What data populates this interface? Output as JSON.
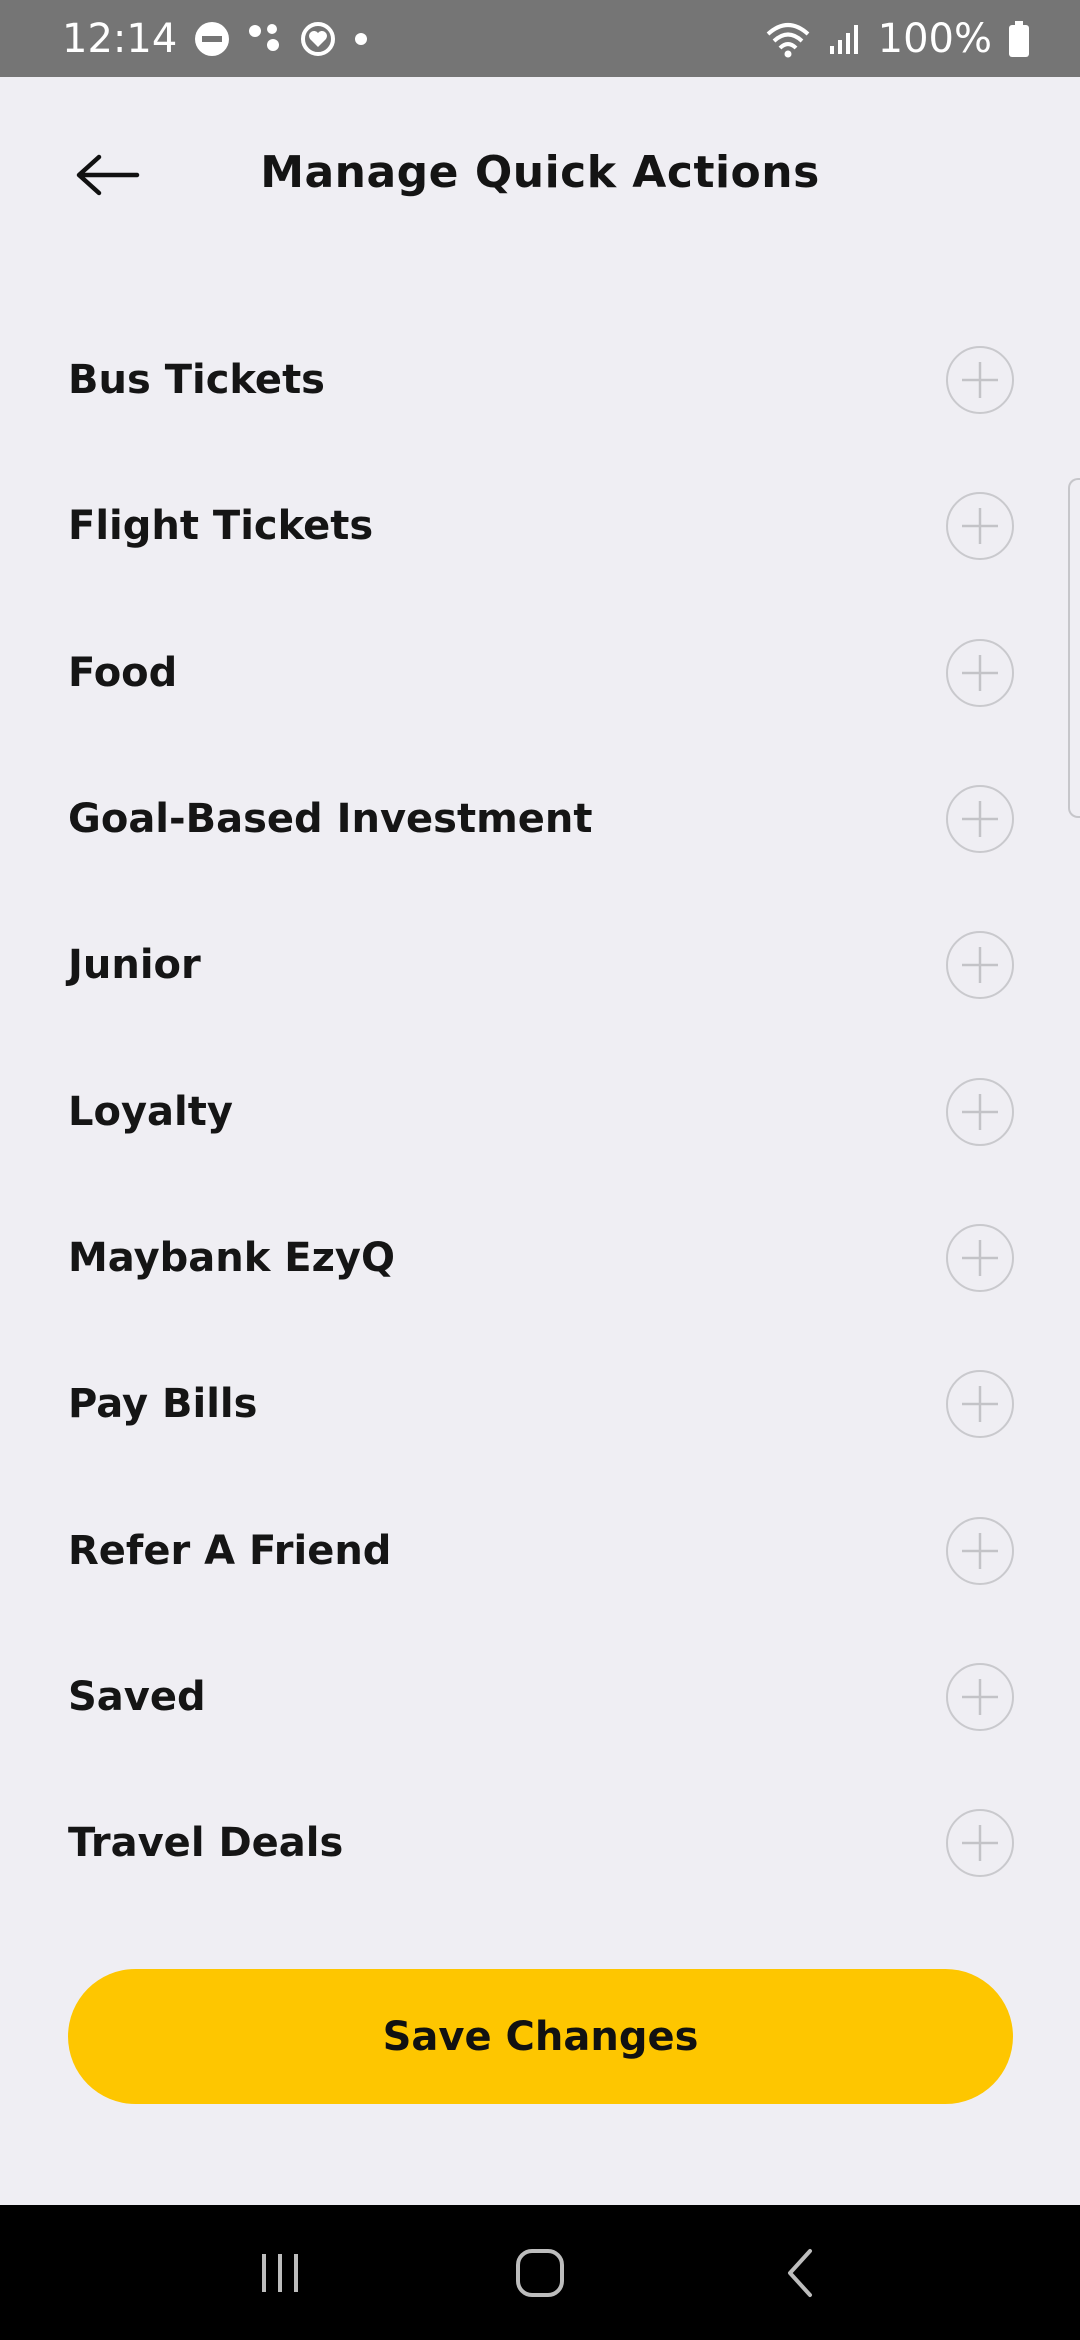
{
  "status_bar": {
    "time": "12:14",
    "battery": "100%"
  },
  "header": {
    "title": "Manage Quick Actions",
    "back_icon": "arrow-left-icon"
  },
  "actions": [
    {
      "label": "Bus Tickets"
    },
    {
      "label": "Flight Tickets"
    },
    {
      "label": "Food"
    },
    {
      "label": "Goal-Based Investment"
    },
    {
      "label": "Junior"
    },
    {
      "label": "Loyalty"
    },
    {
      "label": "Maybank EzyQ"
    },
    {
      "label": "Pay Bills"
    },
    {
      "label": "Refer A Friend"
    },
    {
      "label": "Saved"
    },
    {
      "label": "Travel Deals"
    }
  ],
  "add_icon": "plus-circle-icon",
  "save_button": {
    "label": "Save Changes",
    "color": "#FEC600"
  },
  "nav_bar": {
    "recents_icon": "recents-icon",
    "home_icon": "home-icon",
    "back_icon": "back-chevron-icon"
  }
}
